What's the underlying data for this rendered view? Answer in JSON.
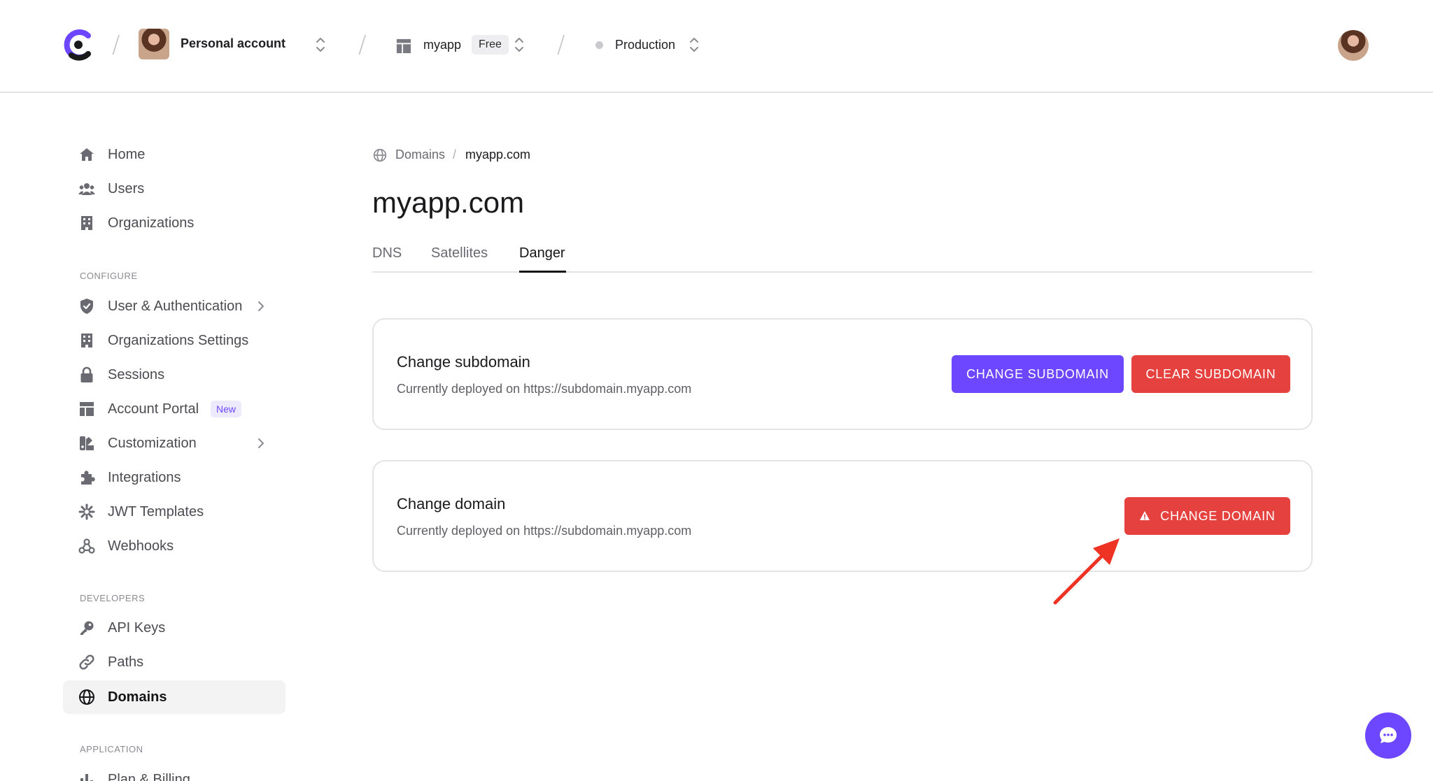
{
  "topbar": {
    "account_label": "Personal account",
    "app_label": "myapp",
    "plan_badge": "Free",
    "environment_label": "Production",
    "separator": "/"
  },
  "sidebar": {
    "primary": [
      {
        "label": "Home",
        "icon": "home-icon"
      },
      {
        "label": "Users",
        "icon": "users-icon"
      },
      {
        "label": "Organizations",
        "icon": "building-icon"
      }
    ],
    "configure_label": "CONFIGURE",
    "configure": [
      {
        "label": "User & Authentication",
        "icon": "shield-icon"
      },
      {
        "label": "Organizations Settings",
        "icon": "building-icon"
      },
      {
        "label": "Sessions",
        "icon": "lock-icon"
      },
      {
        "label": "Account Portal",
        "icon": "layout-icon",
        "badge": "New"
      },
      {
        "label": "Customization",
        "icon": "palette-icon"
      },
      {
        "label": "Integrations",
        "icon": "puzzle-icon"
      },
      {
        "label": "JWT Templates",
        "icon": "asterisk-icon"
      },
      {
        "label": "Webhooks",
        "icon": "webhook-icon"
      }
    ],
    "developers_label": "DEVELOPERS",
    "developers": [
      {
        "label": "API Keys",
        "icon": "key-icon"
      },
      {
        "label": "Paths",
        "icon": "link-icon"
      },
      {
        "label": "Domains",
        "icon": "globe-icon"
      }
    ],
    "application_label": "APPLICATION",
    "application": [
      {
        "label": "Plan & Billing",
        "icon": "chart-icon"
      }
    ]
  },
  "breadcrumb": {
    "parent": "Domains",
    "separator": "/",
    "current": "myapp.com"
  },
  "page": {
    "title": "myapp.com",
    "tabs": [
      {
        "label": "DNS"
      },
      {
        "label": "Satellites"
      },
      {
        "label": "Danger"
      }
    ]
  },
  "cards": {
    "subdomain": {
      "title": "Change subdomain",
      "description": "Currently deployed on https://subdomain.myapp.com",
      "primary_button": "CHANGE SUBDOMAIN",
      "danger_button": "CLEAR SUBDOMAIN"
    },
    "domain": {
      "title": "Change domain",
      "description": "Currently deployed on https://subdomain.myapp.com",
      "danger_button": "CHANGE DOMAIN"
    }
  },
  "colors": {
    "accent": "#6c47ff",
    "danger": "#e5413e",
    "annotation_arrow": "#ee3224"
  }
}
